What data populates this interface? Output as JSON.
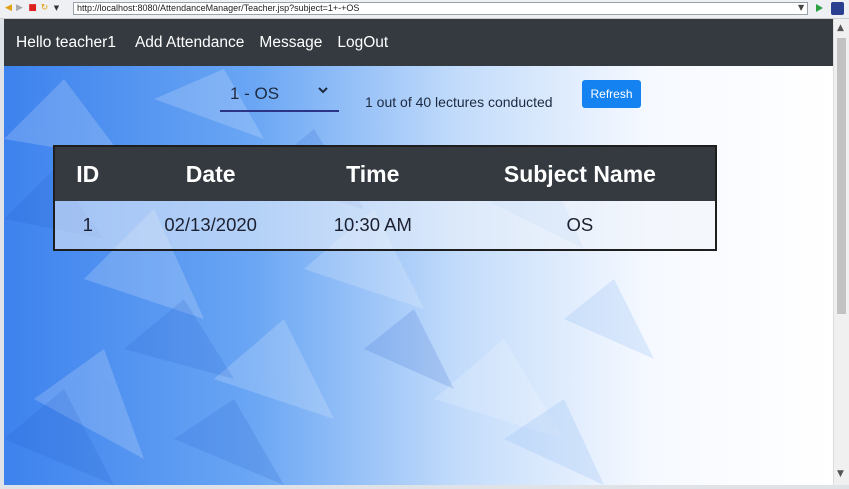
{
  "browser": {
    "url": "http://localhost:8080/AttendanceManager/Teacher.jsp?subject=1+-+OS",
    "icons": [
      "back-icon",
      "forward-icon",
      "stop-icon",
      "refresh-icon",
      "menu-dropdown-icon",
      "go-icon",
      "extension-icon"
    ]
  },
  "navbar": {
    "greeting": "Hello teacher1",
    "links": [
      "Add Attendance",
      "Message",
      "LogOut"
    ],
    "background": "#343a40"
  },
  "controls": {
    "subject_selected": "1 - OS",
    "lectures_status": "1 out of 40 lectures conducted",
    "refresh_label": "Refresh",
    "accent": "#1582f2"
  },
  "table": {
    "headers": [
      "ID",
      "Date",
      "Time",
      "Subject Name"
    ],
    "rows": [
      [
        "1",
        "02/13/2020",
        "10:30 AM",
        "OS"
      ]
    ]
  }
}
